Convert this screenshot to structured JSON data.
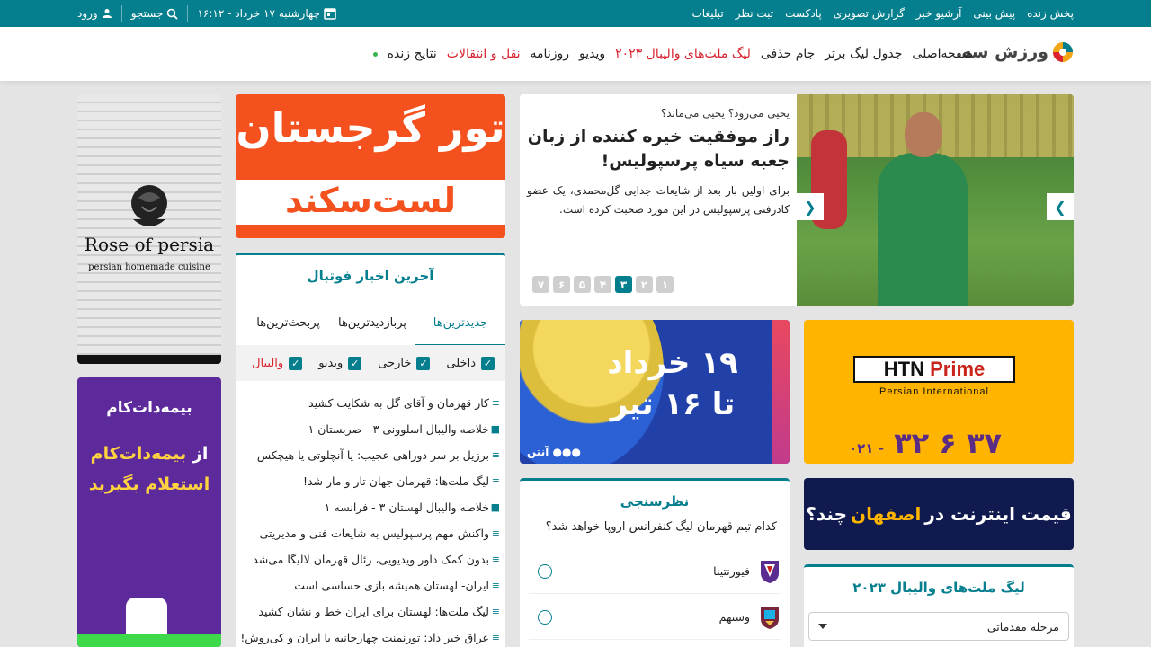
{
  "topbar": {
    "links": [
      "پخش زنده",
      "پیش بینی",
      "آرشیو خبر",
      "گزارش تصویری",
      "پادکست",
      "ثبت نظر",
      "تبلیغات"
    ],
    "date": "چهارشنبه ۱۷ خرداد - ۱۶:۱۲",
    "search_label": "جستجو",
    "login_label": "ورود"
  },
  "header": {
    "logo_text": "ورزش سه",
    "nav": [
      {
        "label": "صفحه‌اصلی",
        "accent": false
      },
      {
        "label": "جدول لیگ برتر",
        "accent": false
      },
      {
        "label": "جام حذفی",
        "accent": false
      },
      {
        "label": "لیگ ملت‌های والیبال ۲۰۲۳",
        "accent": true
      },
      {
        "label": "ویدیو",
        "accent": false
      },
      {
        "label": "روزنامه",
        "accent": false
      },
      {
        "label": "نقل و انتقالات",
        "accent": true
      },
      {
        "label": "نتایج زنده",
        "accent": false
      }
    ]
  },
  "slider": {
    "kicker": "یحیی می‌رود؟ یحیی می‌ماند؟",
    "title": "راز موفقیت خیره کننده از زبان جعبه سیاه پرسپولیس!",
    "lead": "برای اولین بار بعد از شایعات جدایی گل‌محمدی، یک عضو کادرفنی پرسپولیس در این مورد صحبت کرده است.",
    "pages": [
      "۷",
      "۶",
      "۵",
      "۴",
      "۳",
      "۲",
      "۱"
    ],
    "active_page": "۳"
  },
  "ads": {
    "tour_line1": "تور گرجستان",
    "tour_line2": "لست‌سکند",
    "rose_name": "Rose of persia",
    "rose_sub": "persian homemade cuisine",
    "bimeh_brand": "بیمه‌دات‌کام",
    "bimeh_line1_a": "از",
    "bimeh_line1_b": "بیمه‌دات‌کام",
    "bimeh_line2": "استعلام بگیرید",
    "vball_line1": "۱۹ خرداد",
    "vball_line2": "تا ۱۶ تیر",
    "vball_brand": "آنتن",
    "htn_brand_a": "HTN",
    "htn_brand_b": "Prime",
    "htn_sub": "Persian International",
    "htn_code": "۰۲۱ -",
    "htn_number": "۳۲ ۶ ۳۷",
    "inet_a": "قیمت اینترنت در",
    "inet_b": "اصفهان",
    "inet_c": "چند؟"
  },
  "news": {
    "title": "آخرین اخبار فوتبال",
    "tabs": [
      "جدیدترین‌ها",
      "پربازدیدترین‌ها",
      "پربحث‌ترین‌ها"
    ],
    "filters": [
      "داخلی",
      "خارجی",
      "ویدیو",
      "والیبال"
    ],
    "items": [
      {
        "type": "text",
        "title": "کار قهرمان و آقای گل به شکایت کشید"
      },
      {
        "type": "video",
        "title": "خلاصه والیبال اسلوونی ۳ - صربستان ۱"
      },
      {
        "type": "text",
        "title": "برزیل بر سر دوراهی عجیب: یا آنچلوتی یا هیچکس"
      },
      {
        "type": "text",
        "title": "لیگ ملت‌ها: قهرمان جهان تار و مار شد!"
      },
      {
        "type": "video",
        "title": "خلاصه والیبال لهستان ۳ - فرانسه ۱"
      },
      {
        "type": "text",
        "title": "واکنش مهم پرسپولیس به شایعات فنی و مدیریتی"
      },
      {
        "type": "text",
        "title": "بدون کمک داور ویدیویی، رئال قهرمان لالیگا می‌شد"
      },
      {
        "type": "text",
        "title": "ایران- لهستان همیشه بازی حساسی است"
      },
      {
        "type": "text",
        "title": "لیگ ملت‌ها: لهستان برای ایران خط و نشان کشید"
      },
      {
        "type": "text",
        "title": "عراق خبر داد: تورنمنت چهارجانبه با ایران و کی‌روش!"
      }
    ]
  },
  "poll": {
    "title": "نظرسنجی",
    "question": "کدام تیم قهرمان لیگ کنفرانس اروپا خواهد شد؟",
    "options": [
      "فیورنتینا",
      "وستهم"
    ]
  },
  "league": {
    "title": "لیگ ملت‌های والیبال ۲۰۲۳",
    "selected": "مرحله مقدماتی"
  },
  "colors": {
    "primary": "#057f8e",
    "accent_red": "#d9232f"
  }
}
